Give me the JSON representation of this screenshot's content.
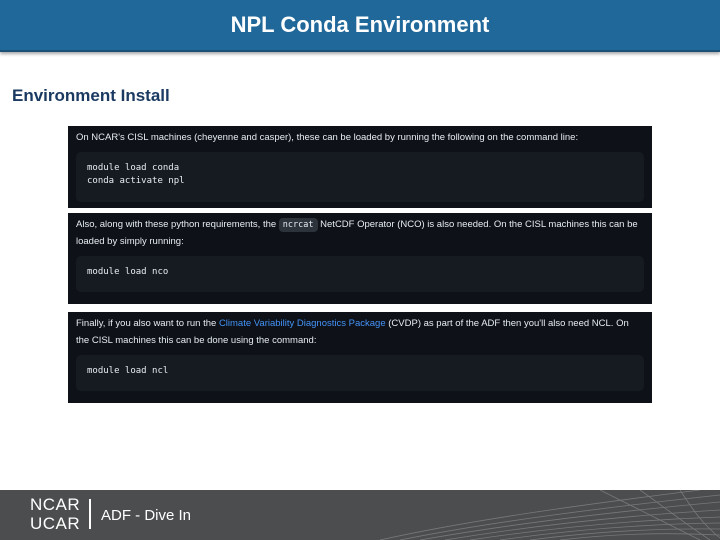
{
  "slide": {
    "title": "NPL Conda Environment",
    "section_heading": "Environment Install"
  },
  "panels": [
    {
      "text": "On NCAR's CISL machines (cheyenne and casper), these can be loaded by running the following on the command line:",
      "code": [
        "module load conda",
        "conda activate npl"
      ]
    },
    {
      "text_before": "Also, along with these python requirements, the ",
      "inline_code": "ncrcat",
      "text_after": " NetCDF Operator (NCO) is also needed. On the CISL machines this can be loaded by simply running:",
      "code": [
        "module load nco"
      ]
    },
    {
      "text_before": "Finally, if you also want to run the ",
      "link": "Climate Variability Diagnostics Package",
      "text_after": " (CVDP) as part of the ADF then you'll also need NCL. On the CISL machines this can be done using the command:",
      "code": [
        "module load ncl"
      ]
    }
  ],
  "footer": {
    "logo_line1": "NCAR",
    "logo_line2": "UCAR",
    "text": "ADF - Dive In"
  }
}
